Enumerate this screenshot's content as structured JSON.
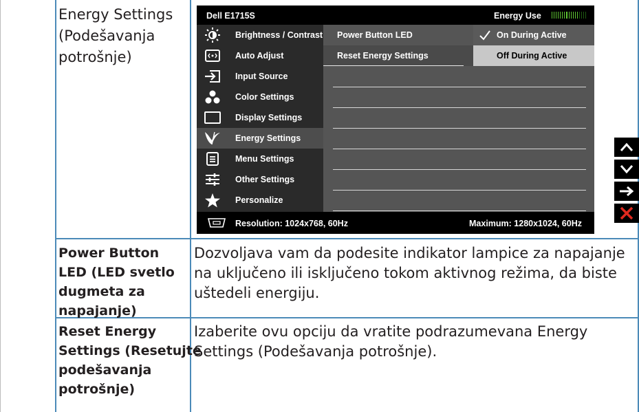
{
  "table": {
    "row1_label": [
      "Energy Settings",
      "(Podešavanja",
      "potrošnje)"
    ],
    "row2_label": [
      "Power Button",
      "LED (LED svetlo",
      "dugmeta za",
      "napajanje)"
    ],
    "row2_desc": [
      "Dozvoljava vam da podesite indikator lampice za napajanje",
      "na uključeno ili isključeno tokom aktivnog režima, da biste",
      "uštedeli energiju."
    ],
    "row3_label": [
      "Reset Energy",
      "Settings (Resetujte",
      "podešavanja",
      "potrošnje)"
    ],
    "row3_desc": [
      "Izaberite ovu opciju da vratite podrazumevana Energy",
      "Settings (Podešavanja potrošnje)."
    ]
  },
  "osd": {
    "title": "Dell E1715S",
    "energy_use_label": "Energy Use",
    "energy_use_level": 0.78,
    "menu": [
      {
        "label": "Brightness / Contrast",
        "icon": "brightness-icon"
      },
      {
        "label": "Auto Adjust",
        "icon": "auto-adjust-icon"
      },
      {
        "label": "Input Source",
        "icon": "input-source-icon"
      },
      {
        "label": "Color Settings",
        "icon": "color-settings-icon"
      },
      {
        "label": "Display Settings",
        "icon": "display-settings-icon"
      },
      {
        "label": "Energy Settings",
        "icon": "energy-settings-icon",
        "selected": true
      },
      {
        "label": "Menu Settings",
        "icon": "menu-settings-icon"
      },
      {
        "label": "Other Settings",
        "icon": "other-settings-icon"
      },
      {
        "label": "Personalize",
        "icon": "personalize-icon"
      }
    ],
    "submenu": [
      "Power Button LED",
      "Reset Energy Settings"
    ],
    "options": [
      {
        "label": "On During Active",
        "checked": true
      },
      {
        "label": "Off During Active",
        "checked": false
      }
    ],
    "resolution": "Resolution: 1024x768, 60Hz",
    "maximum": "Maximum: 1280x1024, 60Hz",
    "side_buttons": [
      "up-arrow-icon",
      "down-arrow-icon",
      "right-arrow-icon",
      "close-icon"
    ],
    "colors": {
      "meter_on": "#5fc832",
      "close": "#e0291e",
      "grid": "#4b8ab8"
    }
  }
}
